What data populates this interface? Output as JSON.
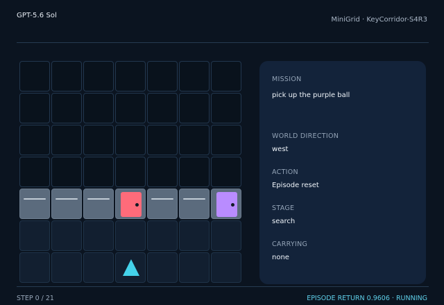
{
  "header": {
    "app_title": "GPT-5.6 Sol",
    "env_name": "MiniGrid · KeyCorridor-S4R3"
  },
  "grid": {
    "columns": 7,
    "rows": 7,
    "cells": [
      [
        "empty",
        "empty",
        "empty",
        "empty",
        "empty",
        "empty",
        "empty"
      ],
      [
        "empty",
        "empty",
        "empty",
        "empty",
        "empty",
        "empty",
        "empty"
      ],
      [
        "empty",
        "empty",
        "empty",
        "empty",
        "empty",
        "empty",
        "empty"
      ],
      [
        "empty",
        "empty",
        "empty",
        "empty",
        "empty",
        "empty",
        "empty"
      ],
      [
        "wall",
        "wall",
        "wall",
        "door-red",
        "wall",
        "wall",
        "door-purple"
      ],
      [
        "floor",
        "floor",
        "floor",
        "floor",
        "floor",
        "floor",
        "floor"
      ],
      [
        "floor",
        "floor",
        "floor",
        "agent",
        "floor",
        "floor",
        "floor"
      ]
    ],
    "colors": {
      "door_red": "#ff6b7a",
      "door_purple": "#b98cff",
      "agent": "#44d2ea",
      "wall": "#5b6b7d"
    },
    "agent_direction": "up"
  },
  "panel": {
    "mission_label": "MISSION",
    "mission_value": "pick up the purple ball",
    "direction_label": "WORLD DIRECTION",
    "direction_value": "west",
    "action_label": "ACTION",
    "action_value": "Episode reset",
    "stage_label": "STAGE",
    "stage_value": "search",
    "carrying_label": "CARRYING",
    "carrying_value": "none"
  },
  "footer": {
    "step_text": "STEP 0 / 21",
    "status_text": "EPISODE RETURN 0.9606 · RUNNING"
  }
}
